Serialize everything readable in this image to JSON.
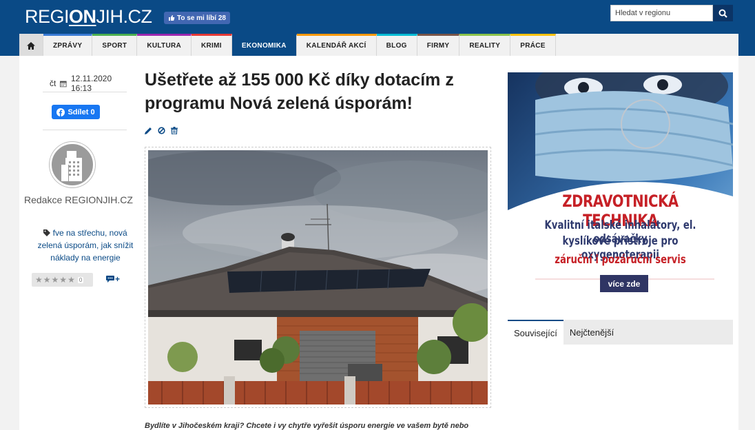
{
  "header": {
    "logo_part1": "REGI",
    "logo_part2": "ON",
    "logo_part3": "JIH.CZ",
    "fb_like_label": "To se mi líbí 28",
    "search_placeholder": "Hledat v regionu"
  },
  "nav": {
    "items": [
      {
        "label": "ZPRÁVY"
      },
      {
        "label": "SPORT"
      },
      {
        "label": "KULTURA"
      },
      {
        "label": "KRIMI"
      },
      {
        "label": "EKONOMIKA"
      },
      {
        "label": "KALENDÁŘ AKCÍ"
      },
      {
        "label": "BLOG"
      },
      {
        "label": "FIRMY"
      },
      {
        "label": "REALITY"
      },
      {
        "label": "PRÁCE"
      }
    ],
    "active": "EKONOMIKA"
  },
  "meta": {
    "day": "čt",
    "date": "12.11.2020 16:13",
    "share_label": "Sdílet 0",
    "author": "Redakce REGIONJIH.CZ",
    "tags": "fve na střechu, nová zelená úsporám, jak snížit náklady na energie",
    "rating_count": "0",
    "comment_plus": "+"
  },
  "article": {
    "title": "Ušetřete až 155 000 Kč díky dotacím z programu Nová zelená úsporám!",
    "lead": "Bydlíte v Jihočeském kraji? Chcete i vy chytře vyřešit úsporu energie ve vašem bytě nebo"
  },
  "ad": {
    "title": "ZDRAVOTNICKÁ TECHNIKA",
    "line1": "Kvalitní italské inhalátory, el. odsávačky",
    "line2": "kyslíkové přístroje pro oxygenoterapii",
    "line3": "záruční i pozáruční servis",
    "button": "více zde"
  },
  "sidebar_tabs": [
    {
      "label": "Související"
    },
    {
      "label": "Nejčtenější"
    }
  ],
  "colors": {
    "brand": "#0a4a86",
    "ad_red": "#c62026",
    "ad_navy": "#2f3564",
    "facebook": "#1877f2"
  }
}
